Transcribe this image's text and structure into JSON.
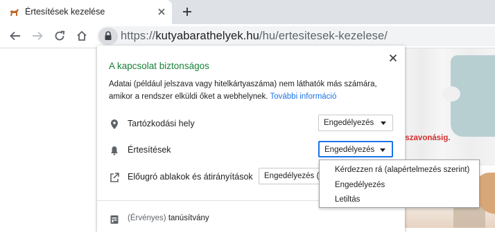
{
  "tab": {
    "title": "Értesítések kezelése"
  },
  "address_bar": {
    "scheme": "https://",
    "host": "kutyabarathelyek.hu",
    "path": "/hu/ertesitesek-kezelese/"
  },
  "page": {
    "promo_text": "sszavonásig."
  },
  "site_info": {
    "title": "A kapcsolat biztonságos",
    "description": "Adatai (például jelszava vagy hitelkártyaszáma) nem láthatók más számára, amikor a rendszer elküldi őket a webhelynek.",
    "more_link": "További információ",
    "permissions": [
      {
        "icon": "location-pin-icon",
        "label": "Tartózkodási hely",
        "value": "Engedélyezés"
      },
      {
        "icon": "bell-icon",
        "label": "Értesítések",
        "value": "Engedélyezés"
      },
      {
        "icon": "external-link-icon",
        "label": "Előugró ablakok és átirányítások",
        "value": "Engedélyezés (a"
      }
    ],
    "certificate": {
      "prefix": "(Érvényes)",
      "label": "tanúsítvány"
    }
  },
  "dropdown": {
    "options": [
      "Kérdezzen rá (alapértelmezés szerint)",
      "Engedélyezés",
      "Letiltás"
    ]
  },
  "colors": {
    "secure_green": "#188038",
    "link_blue": "#1a73e8",
    "promo_red": "#d32f2f"
  }
}
